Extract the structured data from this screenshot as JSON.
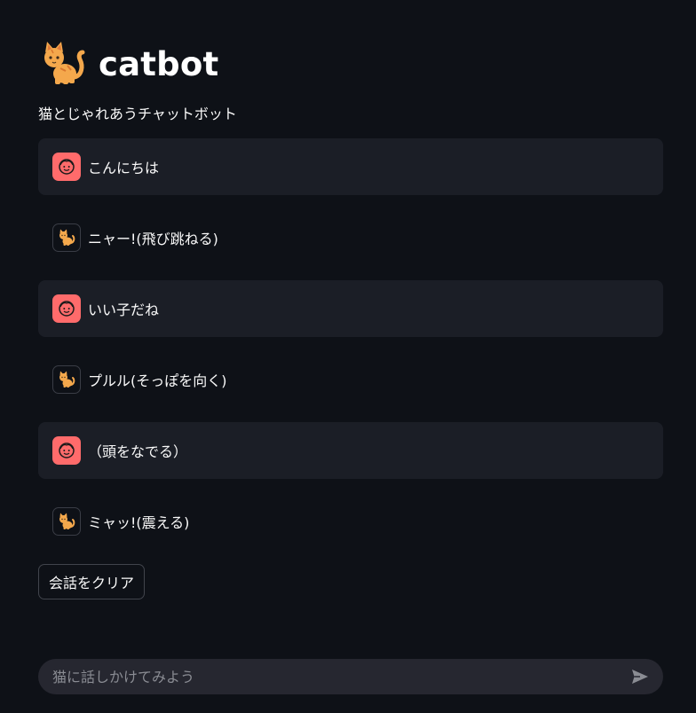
{
  "app": {
    "title": "catbot",
    "subtitle": "猫とじゃれあうチャットボット",
    "logo_icon": "cat-icon"
  },
  "messages": [
    {
      "role": "user",
      "avatar_icon": "smiling-face-icon",
      "text": "こんにちは"
    },
    {
      "role": "assistant",
      "avatar_icon": "cat-icon",
      "text": "ニャー!(飛び跳ねる)"
    },
    {
      "role": "user",
      "avatar_icon": "smiling-face-icon",
      "text": "いい子だね"
    },
    {
      "role": "assistant",
      "avatar_icon": "cat-icon",
      "text": "プルル(そっぽを向く)"
    },
    {
      "role": "user",
      "avatar_icon": "smiling-face-icon",
      "text": "（頭をなでる）"
    },
    {
      "role": "assistant",
      "avatar_icon": "cat-icon",
      "text": "ミャッ!(震える)"
    }
  ],
  "clear_button": {
    "label": "会話をクリア"
  },
  "chat_input": {
    "placeholder": "猫に話しかけてみよう",
    "value": "",
    "send_icon": "send-icon"
  },
  "colors": {
    "background": "#0e1117",
    "user_message_bg": "#1b1e26",
    "user_avatar": "#ff6b6b",
    "input_bg": "#262730"
  }
}
